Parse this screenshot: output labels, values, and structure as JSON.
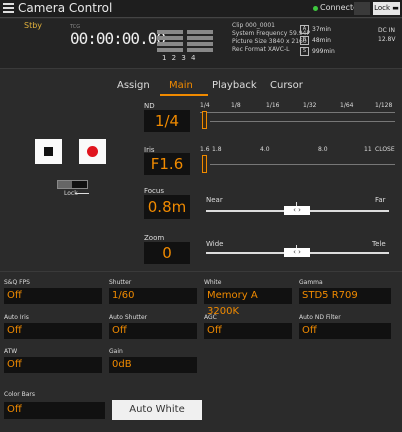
{
  "titlebar": {
    "title": "Camera Control",
    "connection": "Connected",
    "lock": "Lock"
  },
  "status": {
    "stby": "Stby",
    "tcd_label": "TCG",
    "timecode": "00:00:00.00",
    "meter_channels": "1 2 3 4",
    "clip": "Clip 000_0001",
    "system_frequency": "System Frequency 59.94P",
    "picture_size": "Picture Size 3840 x 2160",
    "rec_format": "Rec Format XAVC-L",
    "media": [
      "37min",
      "48min",
      "999min"
    ],
    "dcin_label": "DC IN",
    "voltage": "12.8V"
  },
  "tabs": [
    "Assign",
    "Main",
    "Playback",
    "Cursor"
  ],
  "active_tab": "Main",
  "lock_label": "Lock",
  "nd": {
    "label": "ND",
    "value": "1/4",
    "scale": [
      "1/4",
      "1/8",
      "1/16",
      "1/32",
      "1/64",
      "1/128"
    ]
  },
  "iris": {
    "label": "Iris",
    "value": "F1.6",
    "scale": [
      "1.6",
      "1.8",
      "4.0",
      "8.0",
      "11",
      "CLOSE"
    ]
  },
  "focus": {
    "label": "Focus",
    "value": "0.8m",
    "near": "Near",
    "far": "Far",
    "slider_position": 0.5
  },
  "zoom": {
    "label": "Zoom",
    "value": "0",
    "wide": "Wide",
    "tele": "Tele",
    "slider_position": 0.5
  },
  "settings": {
    "sq_fps": {
      "label": "S&Q FPS",
      "value": "Off"
    },
    "shutter": {
      "label": "Shutter",
      "value": "1/60"
    },
    "white": {
      "label": "White",
      "value": "Memory A 3200K"
    },
    "gamma": {
      "label": "Gamma",
      "value": "STD5 R709"
    },
    "auto_iris": {
      "label": "Auto Iris",
      "value": "Off"
    },
    "auto_shutter": {
      "label": "Auto Shutter",
      "value": "Off"
    },
    "agc": {
      "label": "AGC",
      "value": "Off"
    },
    "auto_nd": {
      "label": "Auto ND Filter",
      "value": "Off"
    },
    "atw": {
      "label": "ATW",
      "value": "Off"
    },
    "gain": {
      "label": "Gain",
      "value": "0dB"
    },
    "color_bars": {
      "label": "Color Bars",
      "value": "Off"
    }
  },
  "auto_white_button": "Auto White",
  "colors": {
    "accent": "#f08a00",
    "rec": "#e0141e",
    "connected": "#3ec83e",
    "stby": "#e0b03c"
  }
}
